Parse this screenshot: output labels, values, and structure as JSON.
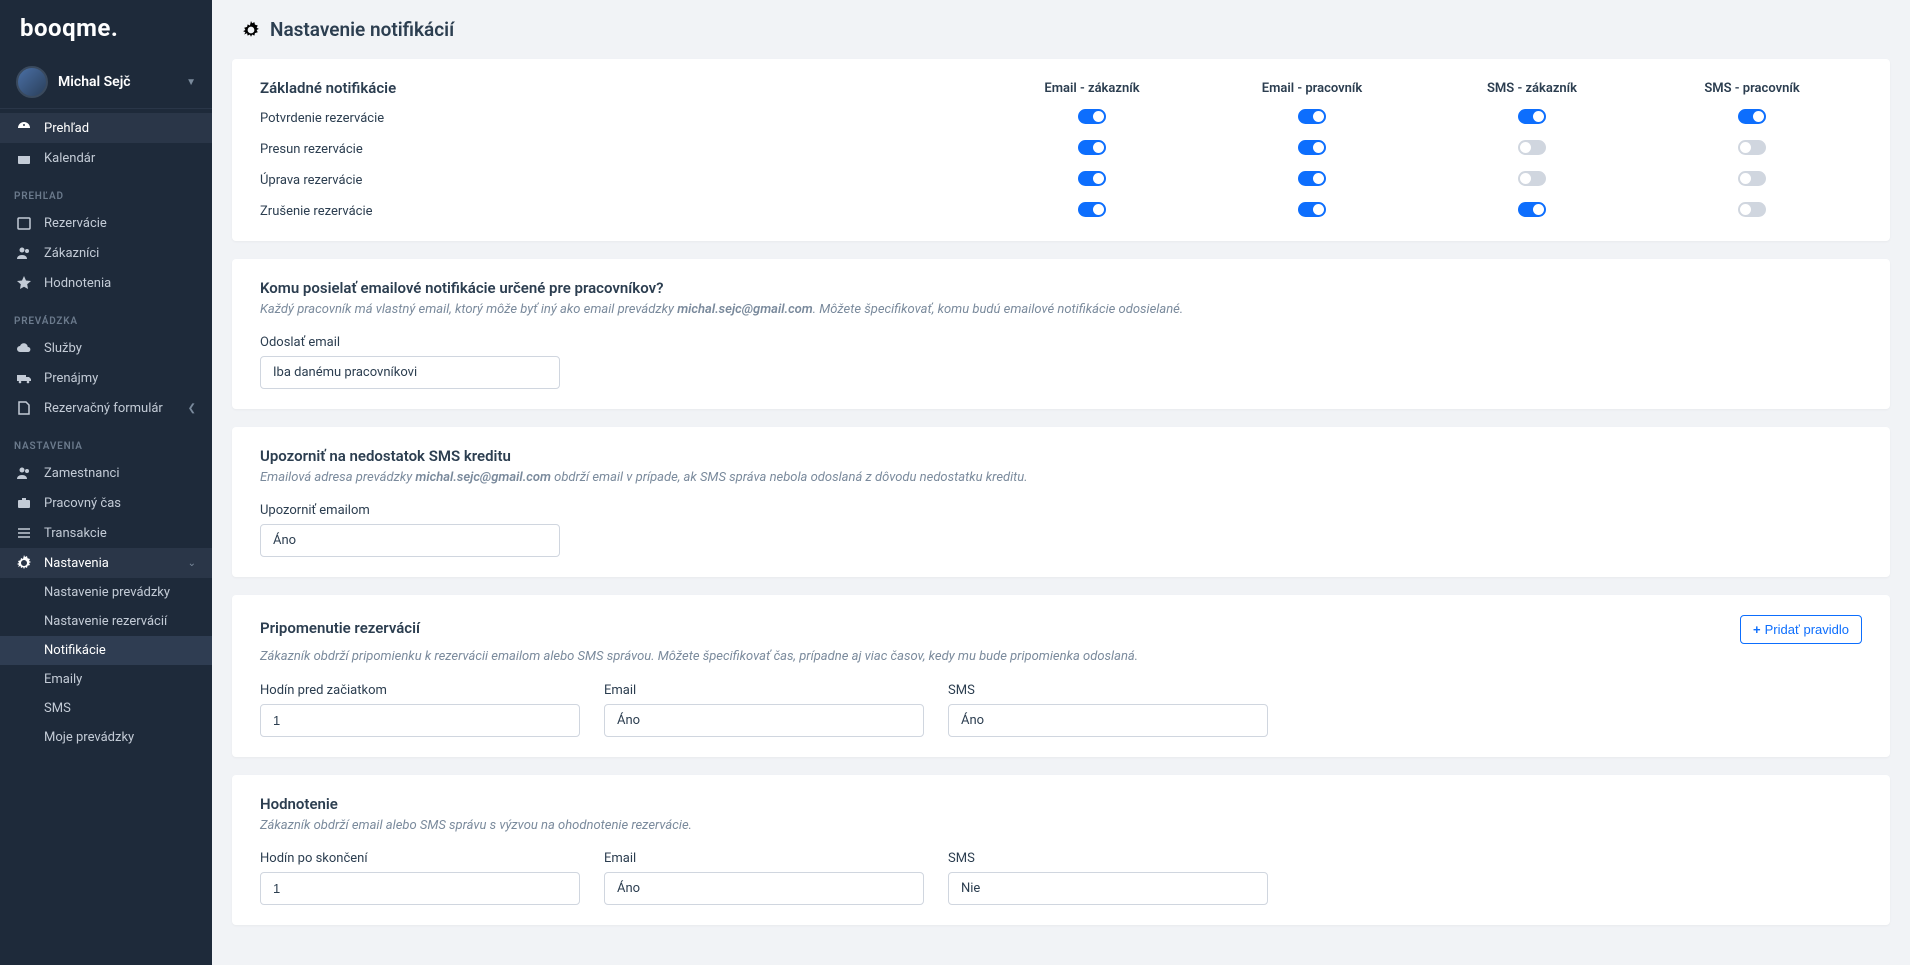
{
  "logo": "booqme.",
  "user": {
    "name": "Michal Sejč"
  },
  "nav": {
    "top": [
      {
        "label": "Prehľad",
        "icon": "dashboard"
      },
      {
        "label": "Kalendár",
        "icon": "calendar"
      }
    ],
    "sections": [
      {
        "heading": "PREHĽAD",
        "items": [
          {
            "label": "Rezervácie",
            "icon": "calendar-event"
          },
          {
            "label": "Zákazníci",
            "icon": "users"
          },
          {
            "label": "Hodnotenia",
            "icon": "star"
          }
        ]
      },
      {
        "heading": "PREVÁDZKA",
        "items": [
          {
            "label": "Služby",
            "icon": "cloud"
          },
          {
            "label": "Prenájmy",
            "icon": "truck"
          },
          {
            "label": "Rezervačný formulár",
            "icon": "file",
            "chevron": true
          }
        ]
      },
      {
        "heading": "NASTAVENIA",
        "items": [
          {
            "label": "Zamestnanci",
            "icon": "users"
          },
          {
            "label": "Pracovný čas",
            "icon": "briefcase"
          },
          {
            "label": "Transakcie",
            "icon": "list"
          },
          {
            "label": "Nastavenia",
            "icon": "gear",
            "chevron_down": true,
            "active": true,
            "children": [
              {
                "label": "Nastavenie prevádzky"
              },
              {
                "label": "Nastavenie rezervácií"
              },
              {
                "label": "Notifikácie",
                "active": true
              },
              {
                "label": "Emaily"
              },
              {
                "label": "SMS"
              },
              {
                "label": "Moje prevádzky"
              }
            ]
          }
        ]
      }
    ]
  },
  "page": {
    "title": "Nastavenie notifikácií"
  },
  "basic": {
    "title": "Základné notifikácie",
    "cols": [
      "Email - zákazník",
      "Email - pracovník",
      "SMS - zákazník",
      "SMS - pracovník"
    ],
    "rows": [
      {
        "label": "Potvrdenie rezervácie",
        "vals": [
          true,
          true,
          true,
          true
        ]
      },
      {
        "label": "Presun rezervácie",
        "vals": [
          true,
          true,
          false,
          false
        ]
      },
      {
        "label": "Úprava rezervácie",
        "vals": [
          true,
          true,
          false,
          false
        ]
      },
      {
        "label": "Zrušenie rezervácie",
        "vals": [
          true,
          true,
          true,
          false
        ]
      }
    ]
  },
  "email_recipient": {
    "title": "Komu posielať emailové notifikácie určené pre pracovníkov?",
    "desc_pre": "Každý pracovník má vlastný email, ktorý môže byť iný ako email prevádzky ",
    "desc_email": "michal.sejc@gmail.com",
    "desc_post": ". Môžete špecifikovať, komu budú emailové notifikácie odosielané.",
    "label": "Odoslať email",
    "value": "Iba danému pracovníkovi"
  },
  "sms_credit": {
    "title": "Upozorniť na nedostatok SMS kreditu",
    "desc_pre": "Emailová adresa prevádzky ",
    "desc_email": "michal.sejc@gmail.com",
    "desc_post": " obdrží email v prípade, ak SMS správa nebola odoslaná z dôvodu nedostatku kreditu.",
    "label": "Upozorniť emailom",
    "value": "Áno"
  },
  "reminder": {
    "title": "Pripomenutie rezervácií",
    "desc": "Zákazník obdrží pripomienku k rezervácii emailom alebo SMS správou. Môžete špecifikovať čas, prípadne aj viac časov, kedy mu bude pripomienka odoslaná.",
    "add_rule": "Pridať pravidlo",
    "labels": {
      "hours": "Hodín pred začiatkom",
      "email": "Email",
      "sms": "SMS"
    },
    "values": {
      "hours": "1",
      "email": "Áno",
      "sms": "Áno"
    }
  },
  "rating": {
    "title": "Hodnotenie",
    "desc": "Zákazník obdrží email alebo SMS správu s výzvou na ohodnotenie rezervácie.",
    "labels": {
      "hours": "Hodín po skončení",
      "email": "Email",
      "sms": "SMS"
    },
    "values": {
      "hours": "1",
      "email": "Áno",
      "sms": "Nie"
    }
  }
}
